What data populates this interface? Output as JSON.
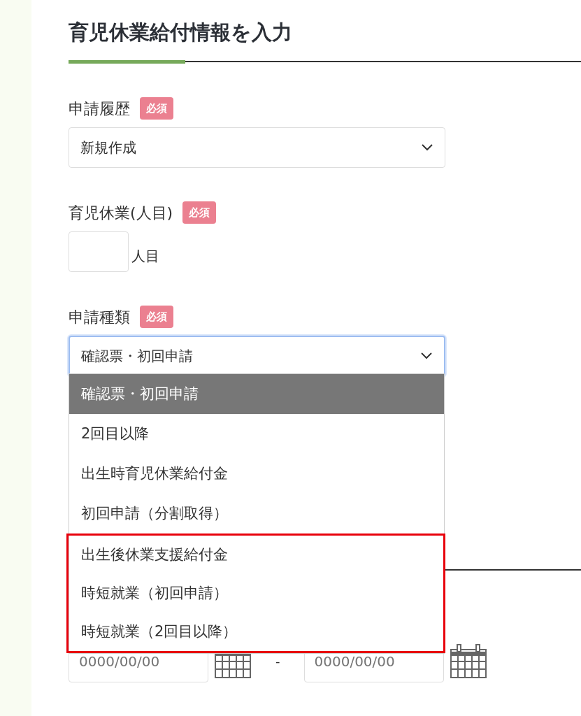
{
  "page_title": "育児休業給付情報を入力",
  "fields": [
    {
      "kind": "select",
      "label": "申請履歴",
      "badge": "必須",
      "value": "新規作成",
      "focused": false
    },
    {
      "kind": "count",
      "label": "育児休業(人目)",
      "badge": "必須",
      "suffix": "人目"
    },
    {
      "kind": "select",
      "label": "申請種類",
      "badge": "必須",
      "value": "確認票・初回申請",
      "focused": true,
      "options": [
        {
          "label": "確認票・初回申請",
          "selected": true,
          "boxed": false
        },
        {
          "label": "2回目以降",
          "selected": false,
          "boxed": false
        },
        {
          "label": "出生時育児休業給付金",
          "selected": false,
          "boxed": false
        },
        {
          "label": "初回申請（分割取得）",
          "selected": false,
          "boxed": false
        },
        {
          "label": "出生後休業支援給付金",
          "selected": false,
          "boxed": true
        },
        {
          "label": "時短就業（初回申請）",
          "selected": false,
          "boxed": true
        },
        {
          "label": "時短就業（2回目以降）",
          "selected": false,
          "boxed": true
        }
      ]
    }
  ],
  "date_range": {
    "start_placeholder": "0000/00/00",
    "separator": "-",
    "end_placeholder": "0000/00/00"
  }
}
